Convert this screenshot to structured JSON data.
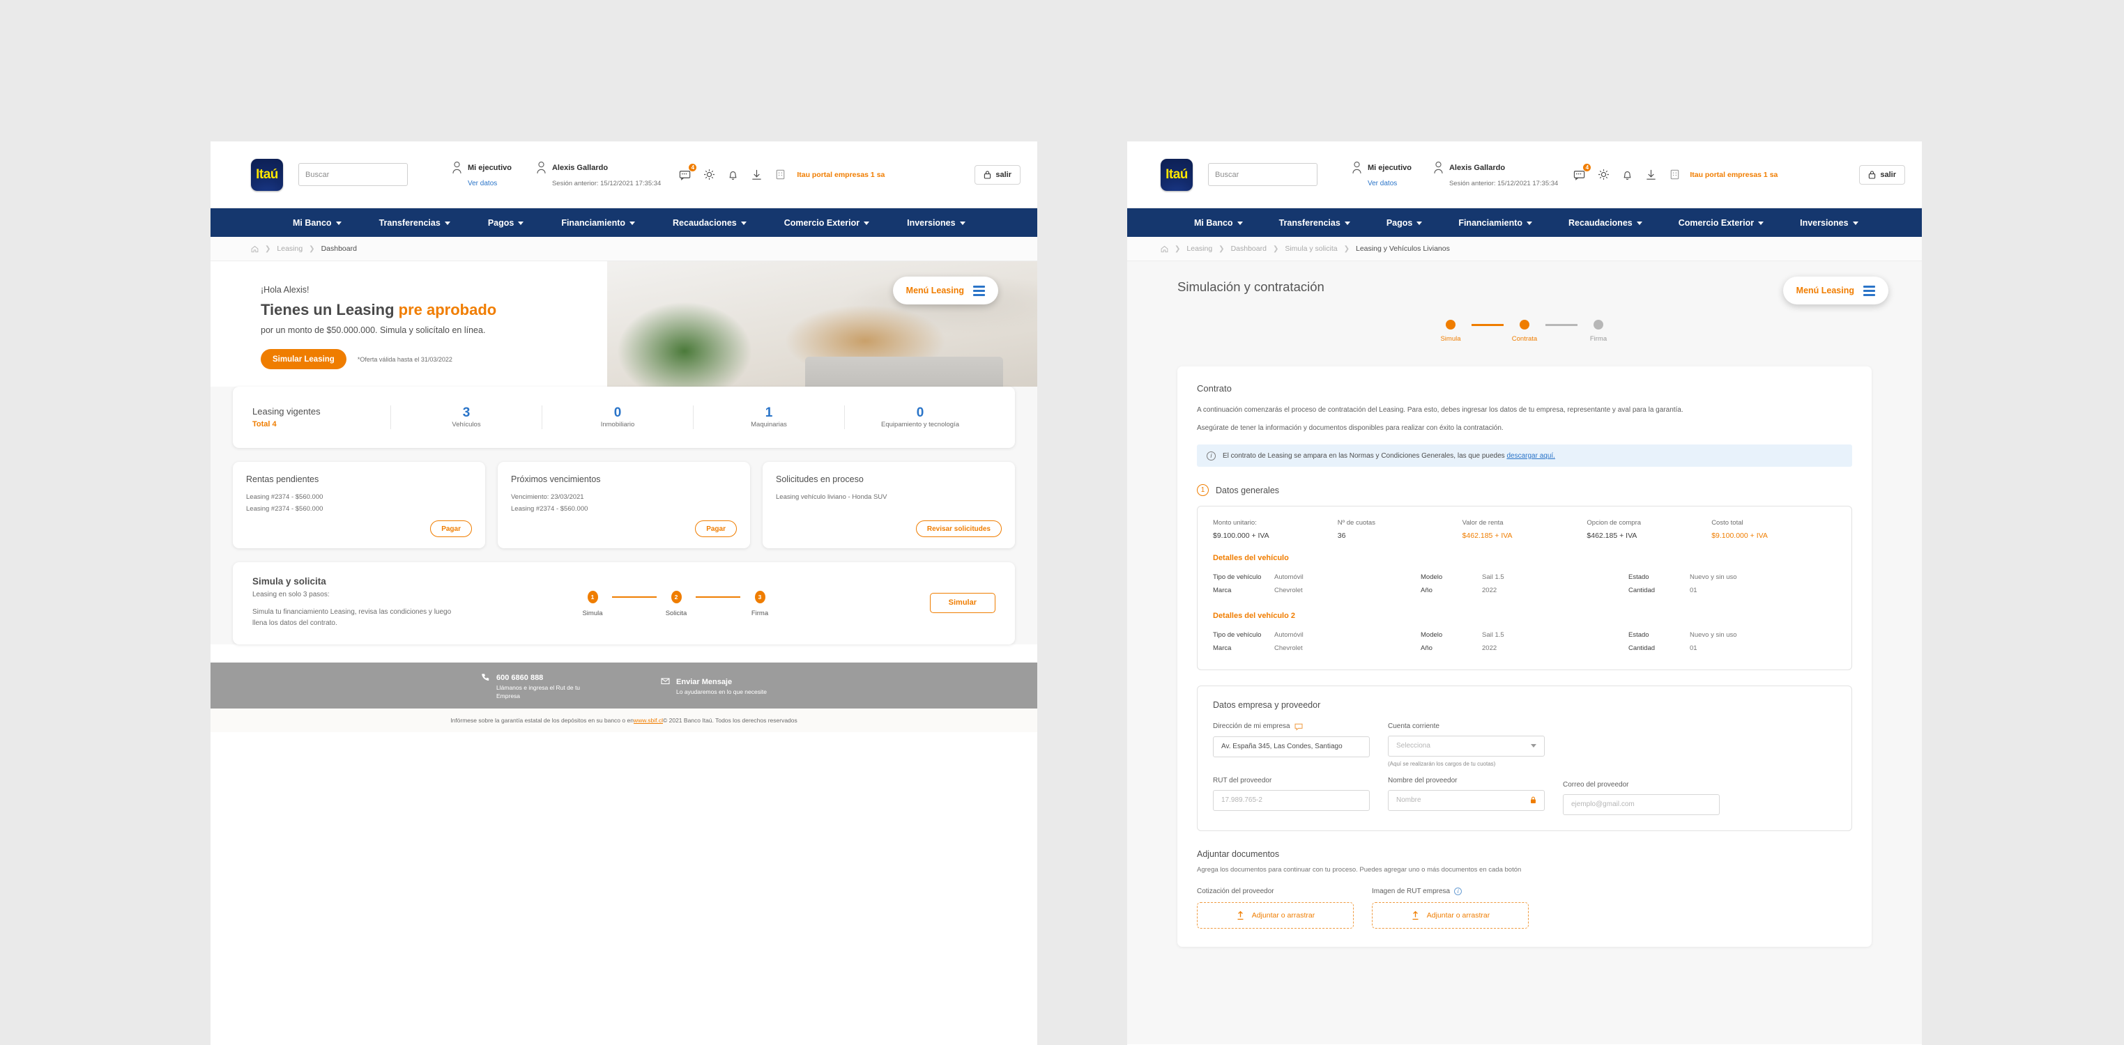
{
  "brand": {
    "logo_text": "Itaú",
    "accent": "#ef7d00",
    "navy": "#15376e",
    "link_blue": "#2a74c8"
  },
  "topbar": {
    "search_placeholder": "Buscar",
    "executive": {
      "title": "Mi ejecutivo",
      "link": "Ver datos"
    },
    "user": {
      "name": "Alexis Gallardo",
      "session": "Sesión anterior: 15/12/2021 17:35:34"
    },
    "icons": [
      {
        "name": "messages-icon",
        "badge": "4"
      },
      {
        "name": "gear-icon",
        "badge": ""
      },
      {
        "name": "bell-icon",
        "badge": ""
      },
      {
        "name": "download-icon",
        "badge": ""
      },
      {
        "name": "building-icon",
        "badge": ""
      }
    ],
    "portal_label": "Itau portal empresas 1 sa",
    "logout_label": "salir"
  },
  "nav": [
    {
      "label": "Mi Banco"
    },
    {
      "label": "Transferencias"
    },
    {
      "label": "Pagos"
    },
    {
      "label": "Financiamiento"
    },
    {
      "label": "Recaudaciones"
    },
    {
      "label": "Comercio Exterior"
    },
    {
      "label": "Inversiones"
    }
  ],
  "menu_leasing": {
    "label": "Menú Leasing"
  },
  "left": {
    "breadcrumb": [
      "Leasing",
      "Dashboard"
    ],
    "hero": {
      "greeting": "¡Hola Alexis!",
      "headline_1": "Tienes un Leasing ",
      "headline_highlight": "pre aprobado",
      "subline": "por un monto de $50.000.000.  Simula y solicítalo en línea.",
      "cta": "Simular Leasing",
      "note": "*Oferta válida hasta el 31/03/2022",
      "dots_count": 4,
      "dots_active": 0
    },
    "summary": {
      "title": "Leasing vigentes",
      "total": "Total 4",
      "cells": [
        {
          "value": "3",
          "label": "Vehículos"
        },
        {
          "value": "0",
          "label": "Inmobiliario"
        },
        {
          "value": "1",
          "label": "Maquinarias"
        },
        {
          "value": "0",
          "label": "Equipamiento y tecnología"
        }
      ]
    },
    "mini_cards": [
      {
        "title": "Rentas pendientes",
        "lines": [
          "Leasing #2374 - $560.000",
          "Leasing #2374 - $560.000"
        ],
        "button": "Pagar"
      },
      {
        "title": "Próximos vencimientos",
        "lines": [
          "Vencimiento: 23/03/2021",
          "Leasing #2374 - $560.000"
        ],
        "button": "Pagar"
      },
      {
        "title": "Solicitudes en proceso",
        "lines": [
          "Leasing vehículo liviano - Honda SUV"
        ],
        "button": "Revisar solicitudes"
      }
    ],
    "simula": {
      "title": "Simula y solicita",
      "subtitle": "Leasing en solo 3 pasos:",
      "paragraph": "Simula tu financiamiento Leasing, revisa las condiciones y luego llena los datos del contrato.",
      "steps": [
        {
          "num": "1",
          "label": "Simula"
        },
        {
          "num": "2",
          "label": "Solicita"
        },
        {
          "num": "3",
          "label": "Firma"
        }
      ],
      "button": "Simular"
    },
    "footer": {
      "phone_title": "600 6860 888",
      "phone_sub": "Llámanos e ingresa el Rut de tu Empresa",
      "msg_title": "Enviar Mensaje",
      "msg_sub": "Lo ayudaremos en lo que necesite",
      "legal_pre": "Infórmese sobre la garantía estatal de los depósitos en su banco o en ",
      "legal_link": "www.sbif.cl",
      "legal_post": " © 2021 Banco Itaú. Todos los derechos reservados"
    }
  },
  "right": {
    "breadcrumb": [
      "Leasing",
      "Dashboard",
      "Simula y solicita",
      "Leasing y Vehículos Livianos"
    ],
    "page_title": "Simulación y contratación",
    "progress": [
      {
        "label": "Simula",
        "done": true
      },
      {
        "label": "Contrata",
        "done": true
      },
      {
        "label": "Firma",
        "done": false
      }
    ],
    "contract": {
      "heading": "Contrato",
      "p1": "A continuación comenzarás el proceso de contratación del Leasing. Para esto, debes ingresar los datos de tu empresa, representante y aval para la garantía.",
      "p2": "Asegúrate de tener la información y documentos disponibles para realizar con éxito la contratación.",
      "info_text": "El contrato de Leasing se ampara en las Normas y Condiciones Generales, las que puedes ",
      "info_link": "descargar aquí."
    },
    "section1": {
      "num": "1",
      "title": "Datos generales"
    },
    "generales": [
      {
        "label": "Monto unitario:",
        "value": "$9.100.000 + IVA",
        "highlight": false
      },
      {
        "label": "Nº de cuotas",
        "value": "36",
        "highlight": false
      },
      {
        "label": "Valor de renta",
        "value": "$462.185 + IVA",
        "highlight": true
      },
      {
        "label": "Opcion de compra",
        "value": "$462.185 + IVA",
        "highlight": false
      },
      {
        "label": "Costo total",
        "value": "$9.100.000 + IVA",
        "highlight": true
      }
    ],
    "vehicles": [
      {
        "heading": "Detalles del vehículo",
        "col1": [
          {
            "k": "Tipo de vehículo",
            "v": "Automóvil"
          },
          {
            "k": "Marca",
            "v": "Chevrolet"
          }
        ],
        "col2": [
          {
            "k": "Modelo",
            "v": "Sail 1.5"
          },
          {
            "k": "Año",
            "v": "2022"
          }
        ],
        "col3": [
          {
            "k": "Estado",
            "v": "Nuevo y sin uso"
          },
          {
            "k": "Cantidad",
            "v": "01"
          }
        ]
      },
      {
        "heading": "Detalles del vehículo 2",
        "col1": [
          {
            "k": "Tipo de vehículo",
            "v": "Automóvil"
          },
          {
            "k": "Marca",
            "v": "Chevrolet"
          }
        ],
        "col2": [
          {
            "k": "Modelo",
            "v": "Sail 1.5"
          },
          {
            "k": "Año",
            "v": "2022"
          }
        ],
        "col3": [
          {
            "k": "Estado",
            "v": "Nuevo y sin uso"
          },
          {
            "k": "Cantidad",
            "v": "01"
          }
        ]
      }
    ],
    "empresa": {
      "heading": "Datos empresa y proveedor",
      "direccion_label": "Dirección de mi empresa",
      "direccion_value": "Av. España 345, Las Condes, Santiago",
      "cuenta_label": "Cuenta corriente",
      "cuenta_placeholder": "Selecciona",
      "cuenta_hint": "(Aquí se realizarán los cargos de tu cuotas)",
      "rut_label": "RUT del proveedor",
      "rut_placeholder": "17.989.765-2",
      "nombre_label": "Nombre del proveedor",
      "nombre_placeholder": "Nombre",
      "correo_label": "Correo del proveedor",
      "correo_placeholder": "ejemplo@gmail.com"
    },
    "adjuntar": {
      "heading": "Adjuntar documentos",
      "paragraph": "Agrega los documentos para continuar con tu proceso. Puedes agregar uno o más documentos en cada botón",
      "slots": [
        {
          "label": "Cotización del proveedor",
          "button": "Adjuntar o arrastrar",
          "has_info": false
        },
        {
          "label": "Imagen de RUT empresa",
          "button": "Adjuntar o arrastrar",
          "has_info": true
        }
      ]
    }
  }
}
